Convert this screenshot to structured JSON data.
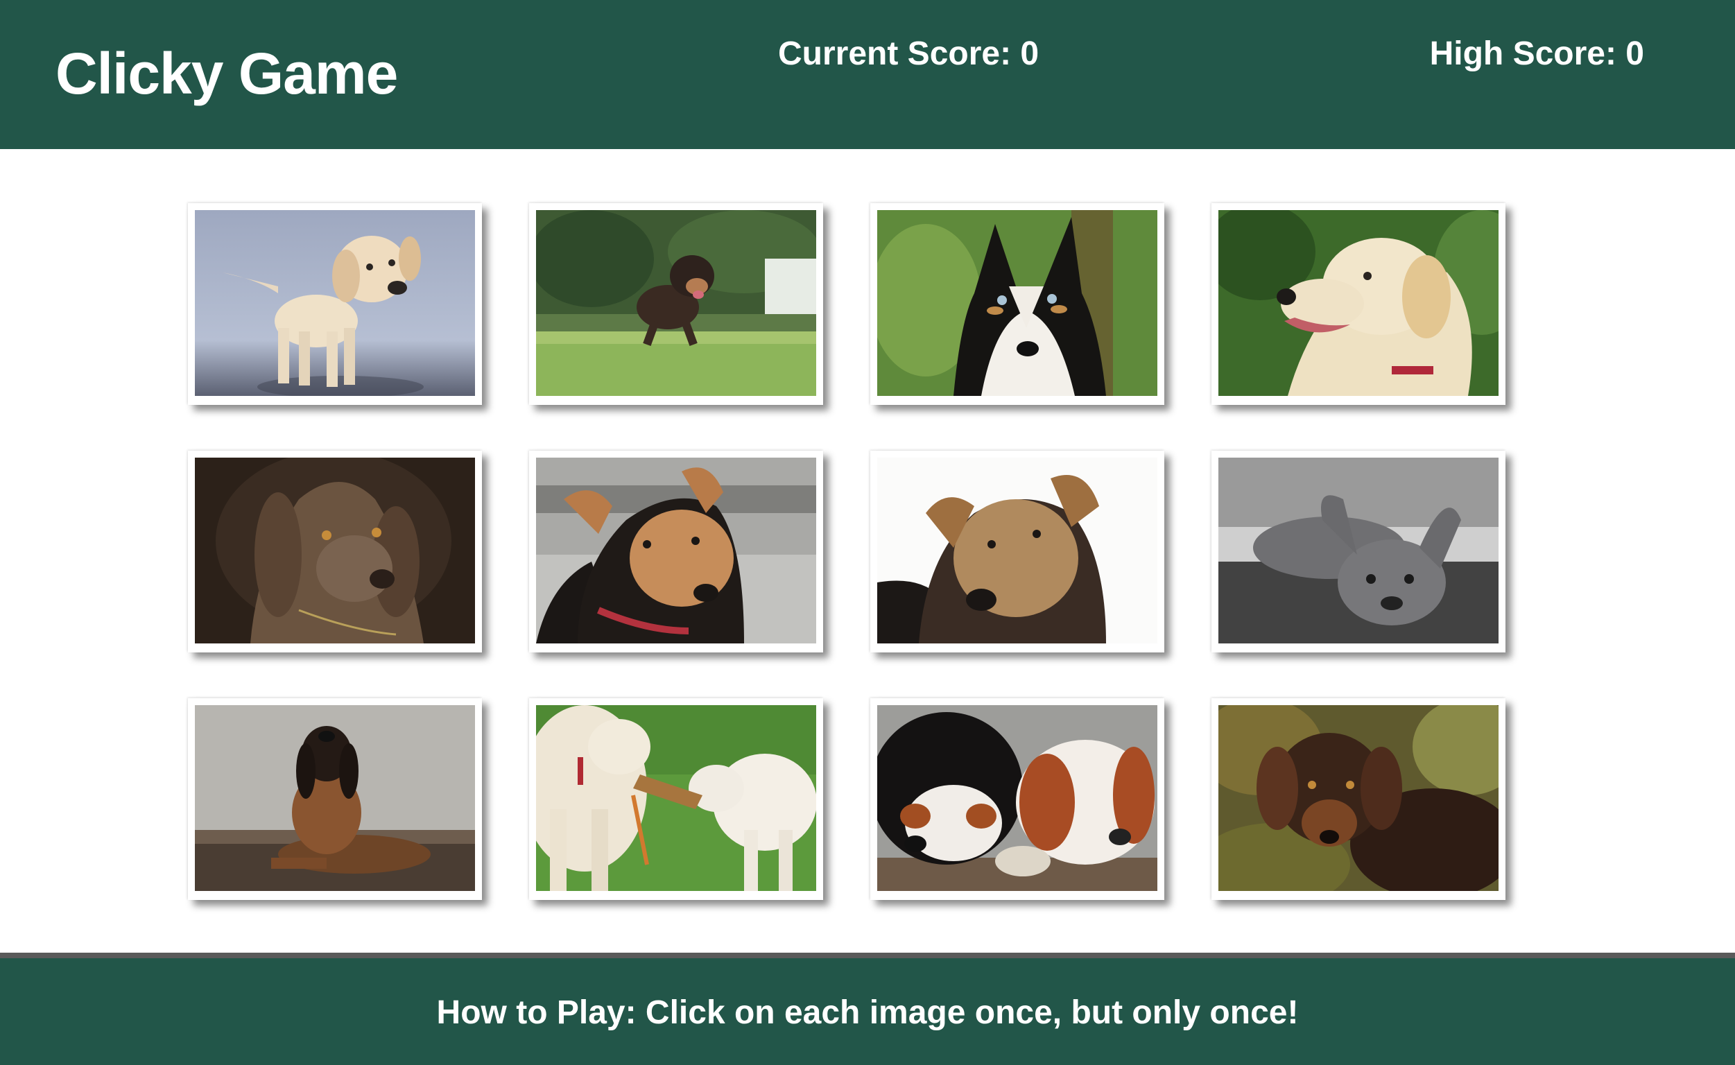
{
  "header": {
    "title": "Clicky Game",
    "current_score_label": "Current Score: 0",
    "high_score_label": "High Score: 0"
  },
  "scores": {
    "current": 0,
    "high": 0
  },
  "cards": [
    {
      "name": "card-puppy-labrador",
      "icon": "labrador-puppy-icon"
    },
    {
      "name": "card-puppy-running",
      "icon": "running-puppy-icon"
    },
    {
      "name": "card-husky-mix",
      "icon": "husky-dog-icon"
    },
    {
      "name": "card-golden-retriever",
      "icon": "golden-retriever-icon"
    },
    {
      "name": "card-weimaraner",
      "icon": "weimaraner-dog-icon"
    },
    {
      "name": "card-shepherd-mix",
      "icon": "shepherd-mix-icon"
    },
    {
      "name": "card-tan-mix",
      "icon": "tan-mix-dog-icon"
    },
    {
      "name": "card-french-bulldog",
      "icon": "french-bulldog-icon"
    },
    {
      "name": "card-hound-lying",
      "icon": "hound-dog-icon"
    },
    {
      "name": "card-two-goldens-tug",
      "icon": "two-dogs-playing-icon"
    },
    {
      "name": "card-spaniels-sleeping",
      "icon": "sleeping-spaniels-icon"
    },
    {
      "name": "card-dachshund",
      "icon": "dachshund-icon"
    }
  ],
  "footer": {
    "instructions": "How to Play: Click on each image once, but only once!"
  },
  "colors": {
    "brand_green": "#225649",
    "text": "#ffffff",
    "divider": "#5a5a5a"
  }
}
